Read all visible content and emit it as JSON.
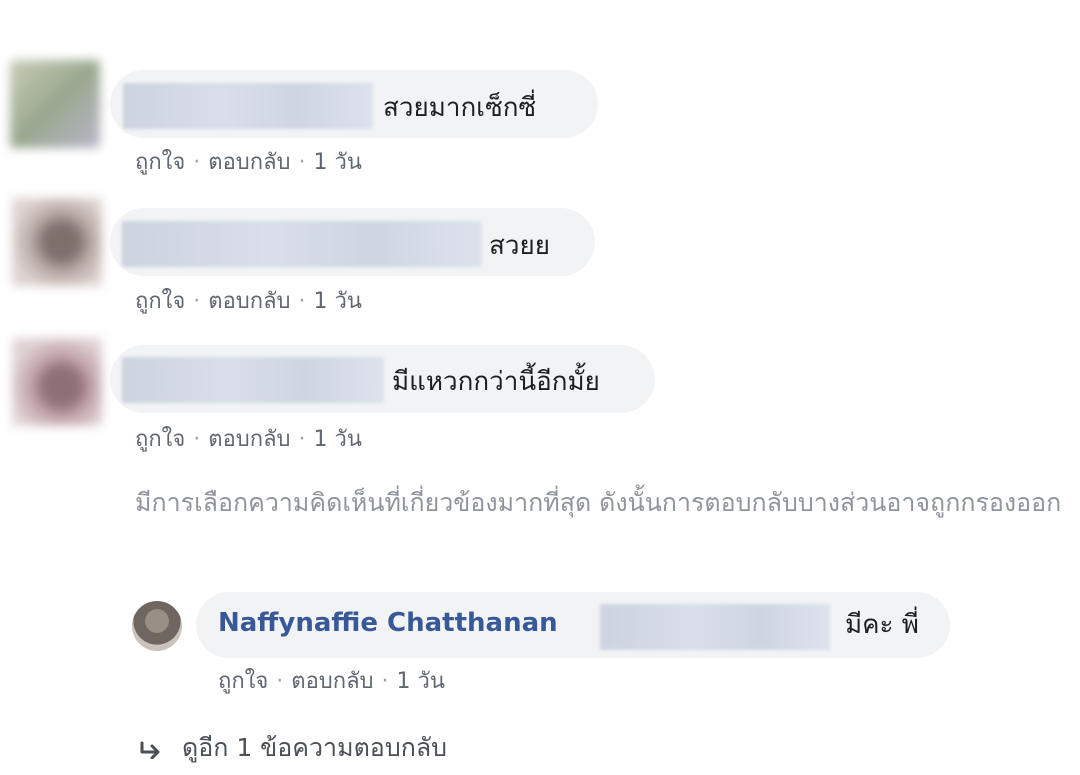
{
  "comments": [
    {
      "text": "สวยมากเซ็กซี่",
      "actions": {
        "like": "ถูกใจ",
        "reply": "ตอบกลับ",
        "time": "1 วัน"
      }
    },
    {
      "text": "สวยย",
      "actions": {
        "like": "ถูกใจ",
        "reply": "ตอบกลับ",
        "time": "1 วัน"
      }
    },
    {
      "text": "มีแหวกกว่านี้อีกมั้ย",
      "actions": {
        "like": "ถูกใจ",
        "reply": "ตอบกลับ",
        "time": "1 วัน"
      }
    }
  ],
  "filter_notice": "มีการเลือกความคิดเห็นที่เกี่ยวข้องมากที่สุด ดังนั้นการตอบกลับบางส่วนอาจถูกกรองออก",
  "reply": {
    "author": "Naffynaffie Chatthanan",
    "text": "มีคะ พี่",
    "actions": {
      "like": "ถูกใจ",
      "reply": "ตอบกลับ",
      "time": "1 วัน"
    }
  },
  "view_more": "ดูอีก 1 ข้อความตอบกลับ",
  "colors": {
    "bubble": "#f2f3f5",
    "name_link": "#385898",
    "meta_text": "#606770",
    "notice_text": "#90949c"
  },
  "icons": {
    "reply_arrow": "reply-arrow-icon"
  }
}
